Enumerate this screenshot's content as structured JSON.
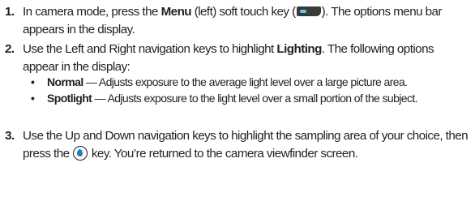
{
  "steps": [
    {
      "number": "1.",
      "before_bold": "In camera mode, press the ",
      "bold": "Menu",
      "after_bold": " (left) soft touch key (",
      "icon": "left-soft-key-icon",
      "after_icon": "). The options menu bar appears in the display."
    },
    {
      "number": "2.",
      "before_bold": "Use the Left and Right navigation keys to highlight ",
      "bold": "Lighting",
      "after_bold": ". The following options appear in the display:"
    },
    {
      "number": "3.",
      "before_icon": "Use the Up and Down navigation keys to highlight the sampling area of your choice, then press the ",
      "icon": "ok-key-icon",
      "after_icon": " key. You’re returned to the camera viewfinder screen."
    }
  ],
  "bullets": [
    {
      "symbol": "•",
      "term": "Normal",
      "description": " — Adjusts exposure to the average light level over a large picture area."
    },
    {
      "symbol": "•",
      "term": "Spotlight",
      "description": " — Adjusts exposure to the light level over a small portion of the subject."
    }
  ]
}
